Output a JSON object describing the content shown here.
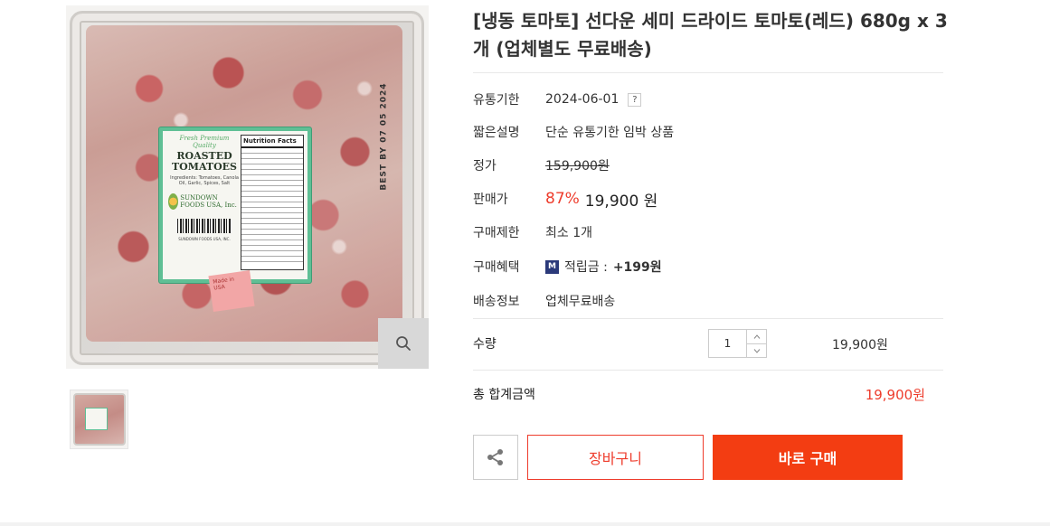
{
  "product": {
    "title": "[냉동 토마토] 선다운 세미 드라이드 토마토(레드) 680g x 3개 (업체별도 무료배송)",
    "image": {
      "best_by": "BEST BY 07 05 2024",
      "label_tag": "Fresh Premium Quality",
      "label_title": "ROASTED TOMATOES",
      "label_ingredients": "Ingredients: Tomatoes, Canola Oil, Garlic, Spices, Salt",
      "label_brand": "SUNDOWN FOODS USA, Inc.",
      "label_address": "SUNDOWN FOODS USA, INC.",
      "nutrition_head": "Nutrition Facts",
      "made_in": "Made in USA"
    }
  },
  "info": {
    "expiry": {
      "label": "유통기한",
      "value": "2024-06-01",
      "help": "?"
    },
    "summary": {
      "label": "짧은설명",
      "value": "단순 유통기한 임박 상품"
    },
    "list_price": {
      "label": "정가",
      "value": "159,900원"
    },
    "sale_price": {
      "label": "판매가",
      "discount": "87%",
      "value": "19,900 원"
    },
    "limit": {
      "label": "구매제한",
      "value": "최소 1개"
    },
    "benefit": {
      "label": "구매혜택",
      "badge": "M",
      "text": "적립금 :",
      "amount": "+199원"
    },
    "shipping": {
      "label": "배송정보",
      "value": "업체무료배송"
    }
  },
  "quantity": {
    "label": "수량",
    "value": "1",
    "price": "19,900원"
  },
  "total": {
    "label": "총 합계금액",
    "value": "19,900원"
  },
  "buttons": {
    "cart": "장바구니",
    "buy": "바로 구매"
  },
  "colors": {
    "accent": "#ee3c2c",
    "buy": "#f33d12",
    "badge": "#2b3a7a"
  }
}
